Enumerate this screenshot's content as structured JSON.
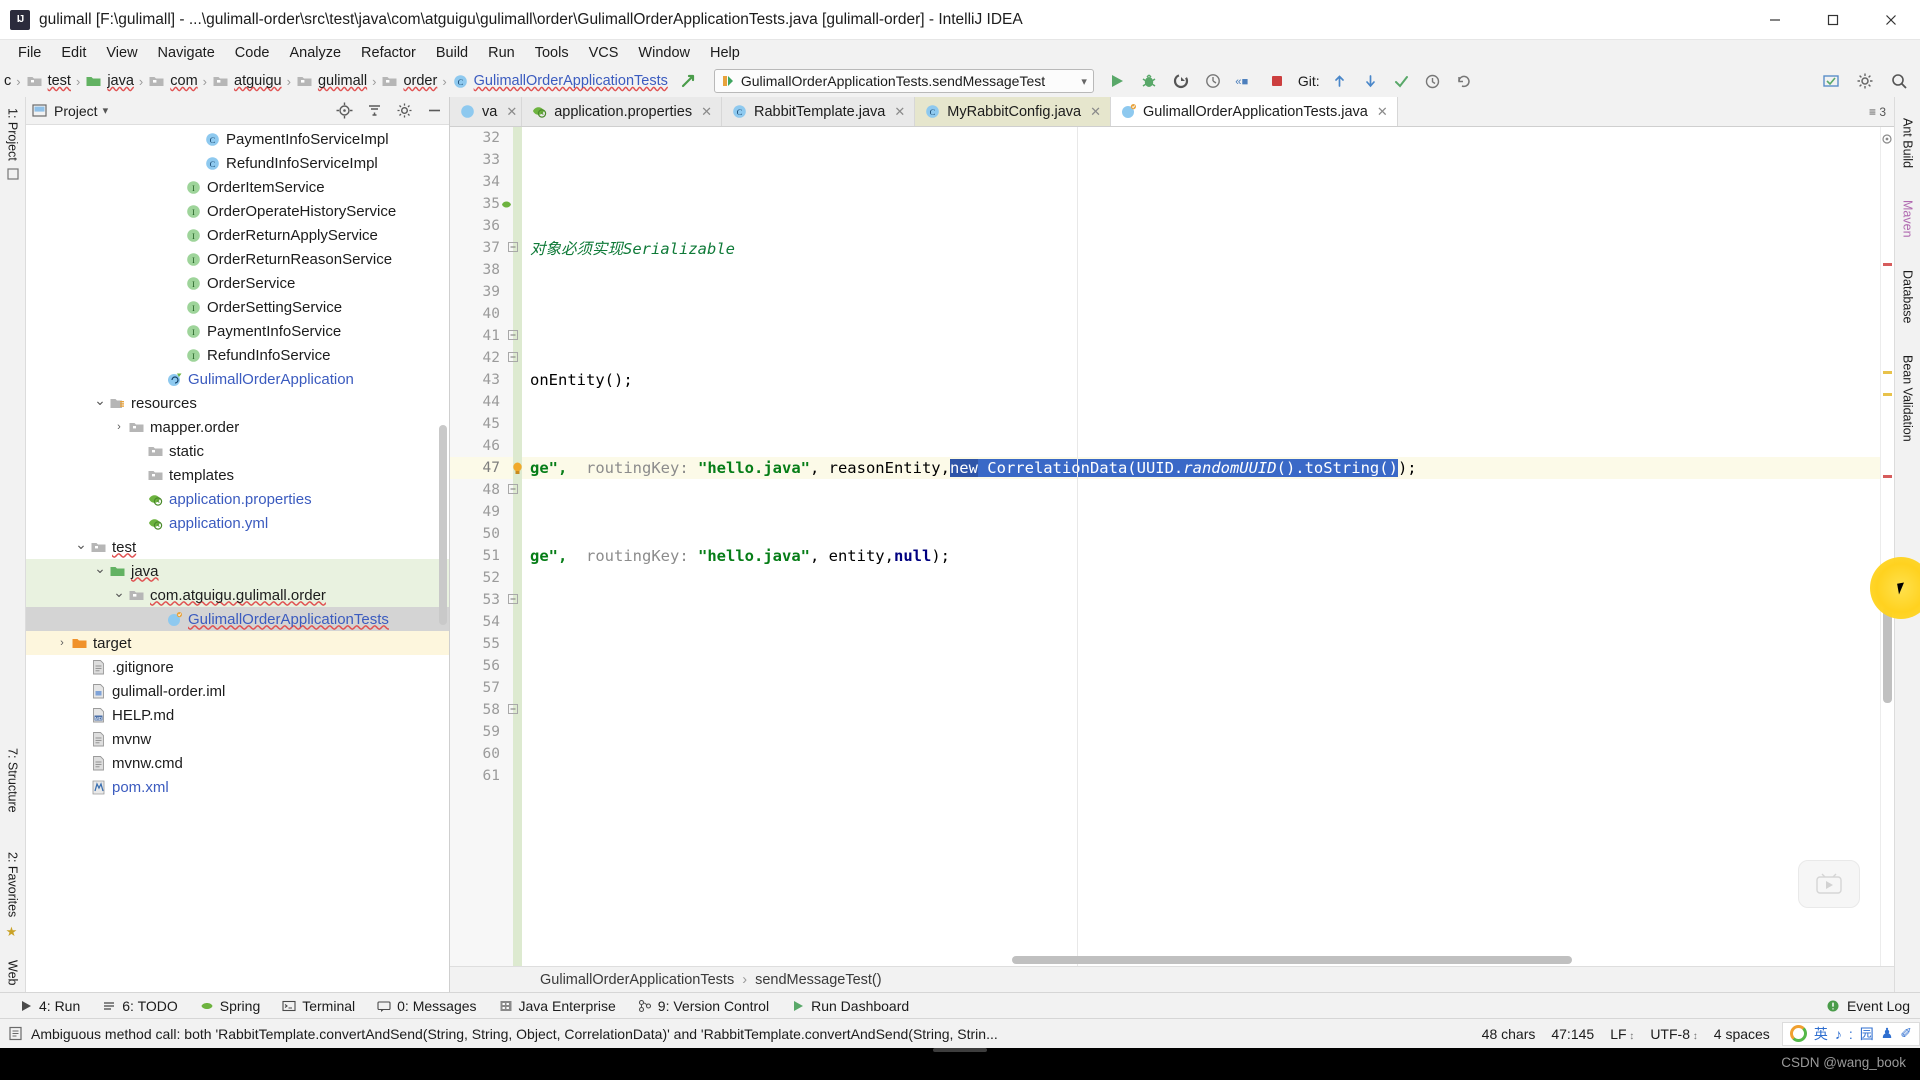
{
  "window": {
    "title": "gulimall [F:\\gulimall] - ...\\gulimall-order\\src\\test\\java\\com\\atguigu\\gulimall\\order\\GulimallOrderApplicationTests.java [gulimall-order] - IntelliJ IDEA",
    "app_badge": "IJ",
    "minimize": "–",
    "maximize": "☐",
    "close": "✕"
  },
  "menubar": {
    "items": [
      {
        "label": "File"
      },
      {
        "label": "Edit"
      },
      {
        "label": "View"
      },
      {
        "label": "Navigate"
      },
      {
        "label": "Code"
      },
      {
        "label": "Analyze"
      },
      {
        "label": "Refactor"
      },
      {
        "label": "Build"
      },
      {
        "label": "Run"
      },
      {
        "label": "Tools"
      },
      {
        "label": "VCS"
      },
      {
        "label": "Window"
      },
      {
        "label": "Help"
      }
    ]
  },
  "breadcrumb": {
    "items": [
      {
        "label": "c",
        "icon": "folder-icon",
        "wavy": false
      },
      {
        "label": "test",
        "icon": "folder-icon",
        "wavy": true
      },
      {
        "label": "java",
        "icon": "folder-green-icon",
        "wavy": true
      },
      {
        "label": "com",
        "icon": "folder-package-icon",
        "wavy": true
      },
      {
        "label": "atguigu",
        "icon": "folder-package-icon",
        "wavy": true
      },
      {
        "label": "gulimall",
        "icon": "folder-package-icon",
        "wavy": true
      },
      {
        "label": "order",
        "icon": "folder-package-icon",
        "wavy": true
      },
      {
        "label": "GulimallOrderApplicationTests",
        "icon": "java-class-icon",
        "wavy": true
      }
    ]
  },
  "toolbar": {
    "run_config": "GulimallOrderApplicationTests.sendMessageTest",
    "dropdown_caret": "⌄",
    "icons": [
      "run-icon",
      "debug-icon",
      "run-with-coverage-icon",
      "profile-icon",
      "build-project-icon",
      "stop-icon"
    ],
    "git_label": "Git:",
    "git_icons": [
      "update-project-icon",
      "commit-icon",
      "check-icon",
      "history-icon",
      "rollback-icon"
    ],
    "right_icons": [
      "select-opened-file-icon",
      "settings-icon",
      "search-everywhere-icon"
    ],
    "make_icon": "make-project-icon"
  },
  "left_rail": {
    "top": [
      "1: Project"
    ],
    "middle": [
      "7: Structure"
    ],
    "bottom": [
      "2: Favorites",
      "Web"
    ]
  },
  "right_rail": {
    "items": [
      "Ant Build",
      "Maven",
      "Database",
      "Bean Validation"
    ]
  },
  "project_panel": {
    "title": "Project",
    "caret": "▾",
    "tools": [
      "locate-icon",
      "collapse-all-icon",
      "settings-icon",
      "hide-icon"
    ],
    "tree": [
      {
        "label": "PaymentInfoServiceImpl",
        "indent": 9,
        "icon": "class-icon",
        "arrow": "",
        "sel": ""
      },
      {
        "label": "RefundInfoServiceImpl",
        "indent": 9,
        "icon": "class-icon",
        "arrow": "",
        "sel": ""
      },
      {
        "label": "OrderItemService",
        "indent": 8,
        "icon": "interface-icon",
        "arrow": "",
        "sel": ""
      },
      {
        "label": "OrderOperateHistoryService",
        "indent": 8,
        "icon": "interface-icon",
        "arrow": "",
        "sel": ""
      },
      {
        "label": "OrderReturnApplyService",
        "indent": 8,
        "icon": "interface-icon",
        "arrow": "",
        "sel": ""
      },
      {
        "label": "OrderReturnReasonService",
        "indent": 8,
        "icon": "interface-icon",
        "arrow": "",
        "sel": ""
      },
      {
        "label": "OrderService",
        "indent": 8,
        "icon": "interface-icon",
        "arrow": "",
        "sel": ""
      },
      {
        "label": "OrderSettingService",
        "indent": 8,
        "icon": "interface-icon",
        "arrow": "",
        "sel": ""
      },
      {
        "label": "PaymentInfoService",
        "indent": 8,
        "icon": "interface-icon",
        "arrow": "",
        "sel": ""
      },
      {
        "label": "RefundInfoService",
        "indent": 8,
        "icon": "interface-icon",
        "arrow": "",
        "sel": ""
      },
      {
        "label": "GulimallOrderApplication",
        "indent": 7,
        "icon": "spring-class-icon",
        "arrow": "",
        "sel": "",
        "blue": true
      },
      {
        "label": "resources",
        "indent": 4,
        "icon": "resources-folder-icon",
        "arrow": "⌄",
        "sel": ""
      },
      {
        "label": "mapper.order",
        "indent": 5,
        "icon": "folder-icon",
        "arrow": "›",
        "sel": ""
      },
      {
        "label": "static",
        "indent": 6,
        "icon": "folder-icon",
        "arrow": "",
        "sel": ""
      },
      {
        "label": "templates",
        "indent": 6,
        "icon": "folder-icon",
        "arrow": "",
        "sel": ""
      },
      {
        "label": "application.properties",
        "indent": 6,
        "icon": "spring-config-icon",
        "arrow": "",
        "sel": "",
        "blue": true
      },
      {
        "label": "application.yml",
        "indent": 6,
        "icon": "spring-config-icon",
        "arrow": "",
        "sel": "",
        "blue": true
      },
      {
        "label": "test",
        "indent": 3,
        "icon": "folder-icon",
        "arrow": "⌄",
        "sel": "",
        "wavy": true
      },
      {
        "label": "java",
        "indent": 4,
        "icon": "folder-green-icon",
        "arrow": "⌄",
        "sel": "sel-green",
        "wavy": true
      },
      {
        "label": "com.atguigu.gulimall.order",
        "indent": 5,
        "icon": "folder-package-icon",
        "arrow": "⌄",
        "sel": "sel-green",
        "wavy": true
      },
      {
        "label": "GulimallOrderApplicationTests",
        "indent": 7,
        "icon": "test-class-icon",
        "arrow": "",
        "sel": "sel-gray",
        "blue": true,
        "wavy": true
      },
      {
        "label": "target",
        "indent": 2,
        "icon": "folder-orange-icon",
        "arrow": "›",
        "sel": "sel-yellow"
      },
      {
        "label": ".gitignore",
        "indent": 3,
        "icon": "file-icon",
        "arrow": "",
        "sel": ""
      },
      {
        "label": "gulimall-order.iml",
        "indent": 3,
        "icon": "iml-icon",
        "arrow": "",
        "sel": ""
      },
      {
        "label": "HELP.md",
        "indent": 3,
        "icon": "md-icon",
        "arrow": "",
        "sel": ""
      },
      {
        "label": "mvnw",
        "indent": 3,
        "icon": "file-icon",
        "arrow": "",
        "sel": ""
      },
      {
        "label": "mvnw.cmd",
        "indent": 3,
        "icon": "file-icon",
        "arrow": "",
        "sel": ""
      },
      {
        "label": "pom.xml",
        "indent": 3,
        "icon": "maven-icon",
        "arrow": "",
        "sel": "",
        "blue": true
      }
    ]
  },
  "editor_tabs": [
    {
      "label": "va",
      "icon": "java-file-icon",
      "state": "partial",
      "close": "✕"
    },
    {
      "label": "application.properties",
      "icon": "spring-config-icon",
      "state": "normal",
      "close": "✕"
    },
    {
      "label": "RabbitTemplate.java",
      "icon": "java-class-icon",
      "state": "normal",
      "close": "✕"
    },
    {
      "label": "MyRabbitConfig.java",
      "icon": "java-class-icon",
      "state": "highlight",
      "close": "✕"
    },
    {
      "label": "GulimallOrderApplicationTests.java",
      "icon": "test-class-icon",
      "state": "active",
      "close": "✕"
    }
  ],
  "editor_tabs_right": {
    "label": "≡ 3"
  },
  "code": {
    "first_line_number": 32,
    "current_line": 47,
    "lines": [
      {
        "n": 32,
        "segments": []
      },
      {
        "n": 33,
        "segments": []
      },
      {
        "n": 34,
        "segments": []
      },
      {
        "n": 35,
        "segments": []
      },
      {
        "n": 36,
        "segments": []
      },
      {
        "n": 37,
        "segments": [
          {
            "t": "对象必须实现Serializable",
            "c": "ital"
          }
        ]
      },
      {
        "n": 38,
        "segments": []
      },
      {
        "n": 39,
        "segments": []
      },
      {
        "n": 40,
        "segments": []
      },
      {
        "n": 41,
        "segments": []
      },
      {
        "n": 42,
        "segments": []
      },
      {
        "n": 43,
        "segments": [
          {
            "t": "onEntity();",
            "c": "plain"
          }
        ]
      },
      {
        "n": 44,
        "segments": []
      },
      {
        "n": 45,
        "segments": []
      },
      {
        "n": 46,
        "segments": []
      },
      {
        "n": 47,
        "segments": [
          {
            "t": "ge\", ",
            "c": "str"
          },
          {
            "t": " routingKey: ",
            "c": "hint"
          },
          {
            "t": "\"hello.java\"",
            "c": "str"
          },
          {
            "t": ", reasonEntity,",
            "c": "plain"
          },
          {
            "t": "new",
            "c": "sel-kw"
          },
          {
            "t": " CorrelationData(UUID.",
            "c": "sel"
          },
          {
            "t": "randomUUID",
            "c": "sel-ital"
          },
          {
            "t": "().toString()",
            "c": "sel"
          },
          {
            "t": ");",
            "c": "plain"
          }
        ]
      },
      {
        "n": 48,
        "segments": []
      },
      {
        "n": 49,
        "segments": []
      },
      {
        "n": 50,
        "segments": []
      },
      {
        "n": 51,
        "segments": [
          {
            "t": "ge\", ",
            "c": "str"
          },
          {
            "t": " routingKey: ",
            "c": "hint"
          },
          {
            "t": "\"hello.java\"",
            "c": "str"
          },
          {
            "t": ", entity,",
            "c": "plain"
          },
          {
            "t": "null",
            "c": "kw"
          },
          {
            "t": ");",
            "c": "plain"
          }
        ]
      },
      {
        "n": 52,
        "segments": []
      },
      {
        "n": 53,
        "segments": []
      },
      {
        "n": 54,
        "segments": []
      },
      {
        "n": 55,
        "segments": []
      },
      {
        "n": 56,
        "segments": []
      },
      {
        "n": 57,
        "segments": []
      },
      {
        "n": 58,
        "segments": []
      },
      {
        "n": 59,
        "segments": []
      },
      {
        "n": 60,
        "segments": []
      },
      {
        "n": 61,
        "segments": []
      }
    ]
  },
  "editor_breadcrumb": {
    "class": "GulimallOrderApplicationTests",
    "sep": "›",
    "method": "sendMessageTest()"
  },
  "tool_windows": {
    "items": [
      {
        "label": "4: Run",
        "icon": "run-icon"
      },
      {
        "label": "6: TODO",
        "icon": "todo-icon"
      },
      {
        "label": "Spring",
        "icon": "spring-icon"
      },
      {
        "label": "Terminal",
        "icon": "terminal-icon"
      },
      {
        "label": "0: Messages",
        "icon": "messages-icon"
      },
      {
        "label": "Java Enterprise",
        "icon": "java-enterprise-icon"
      },
      {
        "label": "9: Version Control",
        "icon": "version-control-icon"
      },
      {
        "label": "Run Dashboard",
        "icon": "run-dashboard-icon"
      }
    ],
    "event_log": "Event Log"
  },
  "statusbar": {
    "message": "Ambiguous method call: both 'RabbitTemplate.convertAndSend(String, String, Object, CorrelationData)' and 'RabbitTemplate.convertAndSend(String, Strin...",
    "chars": "48 chars",
    "caret": "47:145",
    "line_sep": "LF",
    "encoding": "UTF-8",
    "indent": "4 spaces",
    "caret_glyph": "↕",
    "ime": {
      "lang": "英",
      "note": "♪",
      "colon": ":",
      "board": "园",
      "person": "♟",
      "pen": "✐"
    }
  },
  "watermark": {
    "credit": "CSDN @wang_book"
  },
  "colors": {
    "accent_blue": "#3b5bbf",
    "selection": "#3a69c7",
    "string_green": "#067d17",
    "keyword_navy": "#000080",
    "current_line": "#fcfae8",
    "tree_green": "#e9f2e0",
    "cursor_yellow": "#ffd21f"
  }
}
